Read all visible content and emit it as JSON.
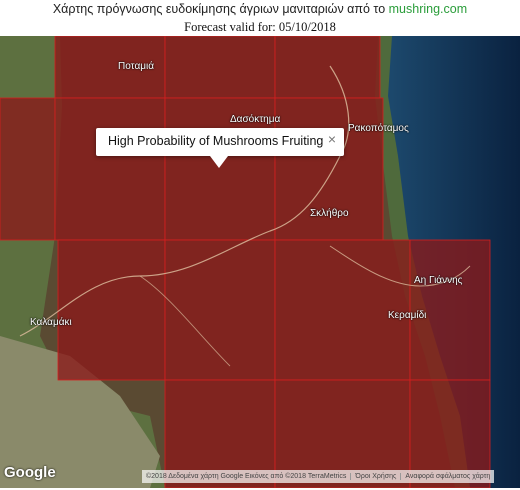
{
  "header": {
    "title_prefix": "Χάρτης πρόγνωσης ευδοκίμησης άγριων μανιταριών από το",
    "site_link": "mushring.com",
    "forecast_label": "Forecast valid for:",
    "forecast_date": "05/10/2018"
  },
  "map": {
    "places": {
      "potamia": "Ποταμιά",
      "dasoktima": "Δασόκτημα",
      "rakopotamos": "Ρακοπόταμος",
      "sklithro": "Σκλήθρο",
      "ag_giannis": "Αη Γιάννης",
      "keramidi": "Κεραμίδι",
      "kalamaki": "Καλαμάκι"
    },
    "popup": {
      "text": "High Probability of Mushrooms Fruiting",
      "close_symbol": "×"
    },
    "google_logo": "Google",
    "attribution": {
      "imagery": "©2018 Δεδομένα χάρτη Google Εικόνες από ©2018 TerraMetrics",
      "terms": "Όροι Χρήσης",
      "report": "Αναφορά σφάλματος χάρτη"
    },
    "colors": {
      "overlay": "#8b1a1a",
      "grid_line": "#d42020",
      "sea": "#0a2a4a",
      "land_green": "#4a6a3a"
    }
  }
}
